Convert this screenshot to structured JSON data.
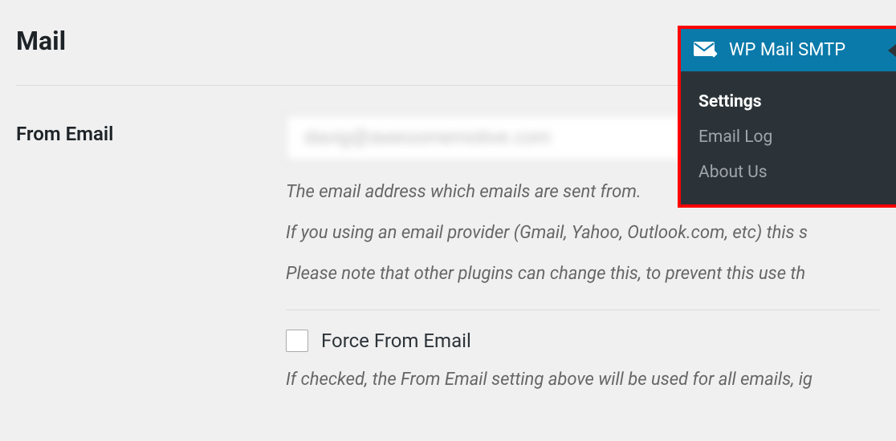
{
  "section": {
    "heading": "Mail"
  },
  "from_email": {
    "label": "From Email",
    "value": "davig@awesomemotive.com",
    "help_line1": "The email address which emails are sent from.",
    "help_line2": "If you using an email provider (Gmail, Yahoo, Outlook.com, etc) this s",
    "help_line3": "Please note that other plugins can change this, to prevent this use th"
  },
  "force_from_email": {
    "label": "Force From Email",
    "help": "If checked, the From Email setting above will be used for all emails, ig"
  },
  "admin_menu": {
    "title": "WP Mail SMTP",
    "items": [
      {
        "label": "Settings",
        "active": true
      },
      {
        "label": "Email Log",
        "active": false
      },
      {
        "label": "About Us",
        "active": false
      }
    ]
  }
}
